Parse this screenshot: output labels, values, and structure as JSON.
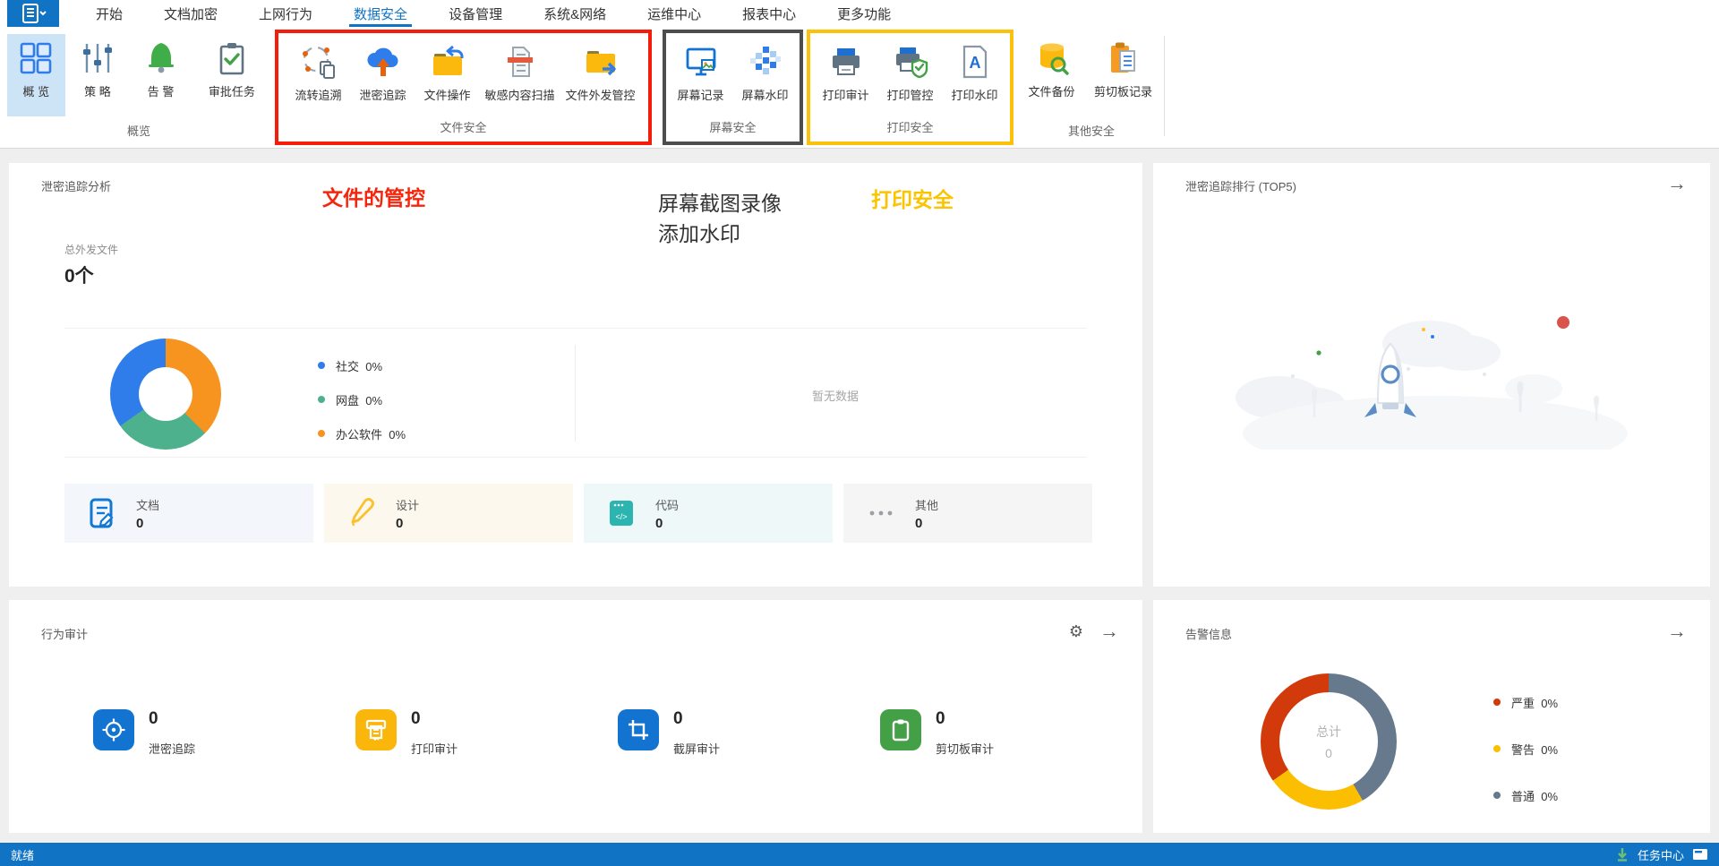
{
  "app": {
    "name_icon": "app-menu-icon",
    "accent_color": "#1073c4"
  },
  "tabs": [
    {
      "label": "开始",
      "active": false
    },
    {
      "label": "文档加密",
      "active": false
    },
    {
      "label": "上网行为",
      "active": false
    },
    {
      "label": "数据安全",
      "active": true
    },
    {
      "label": "设备管理",
      "active": false
    },
    {
      "label": "系统&网络",
      "active": false
    },
    {
      "label": "运维中心",
      "active": false
    },
    {
      "label": "报表中心",
      "active": false
    },
    {
      "label": "更多功能",
      "active": false
    }
  ],
  "ribbon": {
    "groups": [
      {
        "label": "概览",
        "highlight": "none",
        "buttons": [
          {
            "label": "概 览",
            "icon": "overview-grid-icon",
            "selected": true
          },
          {
            "label": "策 略",
            "icon": "sliders-icon"
          },
          {
            "label": "告 警",
            "icon": "bell-icon"
          },
          {
            "label": "审批任务",
            "icon": "clipboard-check-icon"
          }
        ]
      },
      {
        "label": "文件安全",
        "highlight": "red",
        "highlight_color": "#f51d0a",
        "buttons": [
          {
            "label": "流转追溯",
            "icon": "flow-trace-icon"
          },
          {
            "label": "泄密追踪",
            "icon": "leak-cloud-icon"
          },
          {
            "label": "文件操作",
            "icon": "folder-return-icon"
          },
          {
            "label": "敏感内容扫描",
            "icon": "doc-scan-icon"
          },
          {
            "label": "文件外发管控",
            "icon": "folder-out-icon"
          }
        ]
      },
      {
        "label": "屏幕安全",
        "highlight": "dark",
        "highlight_color": "#4d4d4d",
        "buttons": [
          {
            "label": "屏幕记录",
            "icon": "screen-record-icon"
          },
          {
            "label": "屏幕水印",
            "icon": "screen-watermark-icon"
          }
        ]
      },
      {
        "label": "打印安全",
        "highlight": "yellow",
        "highlight_color": "#fcc10a",
        "buttons": [
          {
            "label": "打印审计",
            "icon": "printer-icon"
          },
          {
            "label": "打印管控",
            "icon": "printer-shield-icon"
          },
          {
            "label": "打印水印",
            "icon": "doc-a-icon"
          }
        ]
      },
      {
        "label": "其他安全",
        "highlight": "none",
        "buttons": [
          {
            "label": "文件备份",
            "icon": "db-search-icon"
          },
          {
            "label": "剪切板记录",
            "icon": "clipboard-doc-icon"
          }
        ]
      }
    ]
  },
  "annotations": {
    "file_control": "文件的管控",
    "screen_line1": "屏幕截图录像",
    "screen_line2": "添加水印",
    "print_security": "打印安全"
  },
  "panels": {
    "trace": {
      "title": "泄密追踪分析",
      "total_label": "总外发文件",
      "total_value": "0个",
      "legend": [
        {
          "label": "社交",
          "value": "0%",
          "color": "#2f7dea"
        },
        {
          "label": "网盘",
          "value": "0%",
          "color": "#4eb18e"
        },
        {
          "label": "办公软件",
          "value": "0%",
          "color": "#f7941f"
        }
      ],
      "empty_text": "暂无数据",
      "cards": [
        {
          "label": "文档",
          "value": "0",
          "icon": "doc-pen-icon"
        },
        {
          "label": "设计",
          "value": "0",
          "icon": "pencil-icon"
        },
        {
          "label": "代码",
          "value": "0",
          "icon": "code-window-icon"
        },
        {
          "label": "其他",
          "value": "0",
          "icon": "ellipsis-icon"
        }
      ]
    },
    "rank": {
      "title": "泄密追踪排行 (TOP5)",
      "arrow": "→"
    },
    "audit": {
      "title": "行为审计",
      "gear": "⚙",
      "arrow": "→",
      "stats": [
        {
          "value": "0",
          "label": "泄密追踪",
          "icon": "target-icon",
          "color": "#1274d0"
        },
        {
          "value": "0",
          "label": "打印审计",
          "icon": "print-receipt-icon",
          "color": "#fbb60b"
        },
        {
          "value": "0",
          "label": "截屏审计",
          "icon": "crop-icon",
          "color": "#1274d0"
        },
        {
          "value": "0",
          "label": "剪切板审计",
          "icon": "clipboard-icon",
          "color": "#43a047"
        }
      ]
    },
    "alerts": {
      "title": "告警信息",
      "arrow": "→",
      "center_label": "总计",
      "center_value": "0",
      "legend": [
        {
          "label": "严重",
          "value": "0%",
          "color": "#d23a0c"
        },
        {
          "label": "警告",
          "value": "0%",
          "color": "#fcbe00"
        },
        {
          "label": "普通",
          "value": "0%",
          "color": "#67798c"
        }
      ]
    }
  },
  "statusbar": {
    "ready": "就绪",
    "task_center": "任务中心"
  },
  "chart_data": [
    {
      "type": "pie",
      "title": "泄密追踪分析 外发渠道占比",
      "labels": [
        "社交",
        "网盘",
        "办公软件"
      ],
      "values": [
        0,
        0,
        0
      ],
      "display_percents": [
        "0%",
        "0%",
        "0%"
      ],
      "colors": [
        "#2f7dea",
        "#4eb18e",
        "#f7941f"
      ],
      "legend_position": "right"
    },
    {
      "type": "pie",
      "title": "告警信息",
      "labels": [
        "严重",
        "警告",
        "普通"
      ],
      "values": [
        0,
        0,
        0
      ],
      "display_percents": [
        "0%",
        "0%",
        "0%"
      ],
      "colors": [
        "#d23a0c",
        "#fcbe00",
        "#67798c"
      ],
      "center": {
        "label": "总计",
        "value": 0
      },
      "legend_position": "right"
    }
  ]
}
